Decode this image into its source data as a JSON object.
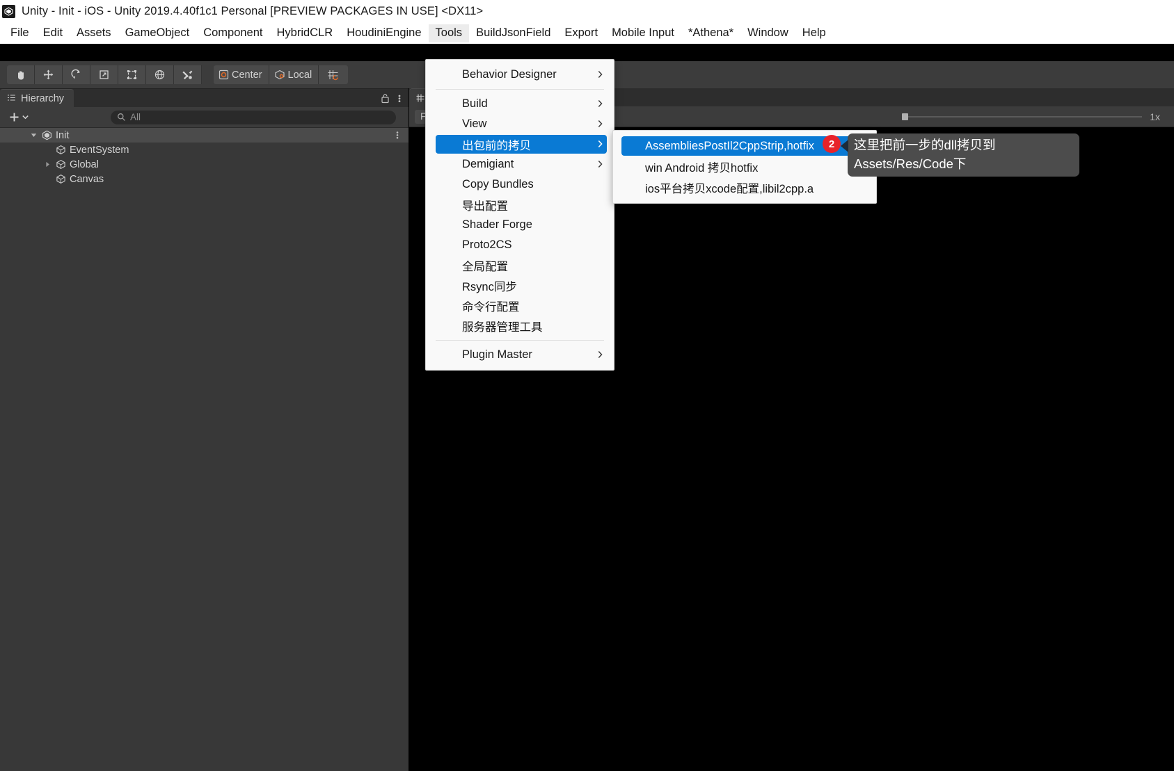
{
  "window": {
    "title": "Unity - Init - iOS - Unity 2019.4.40f1c1 Personal [PREVIEW PACKAGES IN USE] <DX11>",
    "app_icon": "unity-icon"
  },
  "menubar": {
    "items": [
      {
        "label": "File",
        "active": false
      },
      {
        "label": "Edit",
        "active": false
      },
      {
        "label": "Assets",
        "active": false
      },
      {
        "label": "GameObject",
        "active": false
      },
      {
        "label": "Component",
        "active": false
      },
      {
        "label": "HybridCLR",
        "active": false
      },
      {
        "label": "HoudiniEngine",
        "active": false
      },
      {
        "label": "Tools",
        "active": true
      },
      {
        "label": "BuildJsonField",
        "active": false
      },
      {
        "label": "Export",
        "active": false
      },
      {
        "label": "Mobile Input",
        "active": false
      },
      {
        "label": "*Athena*",
        "active": false
      },
      {
        "label": "Window",
        "active": false
      },
      {
        "label": "Help",
        "active": false
      }
    ]
  },
  "toolbar": {
    "tools": [
      {
        "name": "hand-tool"
      },
      {
        "name": "move-tool"
      },
      {
        "name": "rotate-tool"
      },
      {
        "name": "scale-tool"
      },
      {
        "name": "rect-tool"
      },
      {
        "name": "transform-tool"
      },
      {
        "name": "custom-tool"
      }
    ],
    "pivot_mode": "Center",
    "pivot_rotation": "Local",
    "grid_snap": "grid-snap-icon"
  },
  "hierarchy": {
    "tab_label": "Hierarchy",
    "lock_icon": "lock-icon",
    "menu_icon": "kebab-menu-icon",
    "add_label": "+",
    "search": {
      "placeholder": "All",
      "value": "",
      "icon": "search-icon"
    },
    "tree": [
      {
        "label": "Init",
        "depth": 0,
        "icon": "unity-scene-icon",
        "expanded": true,
        "selected": true,
        "has_children": true
      },
      {
        "label": "EventSystem",
        "depth": 1,
        "icon": "gameobject-icon",
        "expanded": false,
        "selected": false,
        "has_children": false
      },
      {
        "label": "Global",
        "depth": 1,
        "icon": "gameobject-icon",
        "expanded": false,
        "selected": false,
        "has_children": true
      },
      {
        "label": "Canvas",
        "depth": 1,
        "icon": "gameobject-icon",
        "expanded": false,
        "selected": false,
        "has_children": false
      }
    ]
  },
  "gameview": {
    "tab_label": "",
    "tab_icon": "game-view-icon",
    "aspect_label": "Fre",
    "zoom_label": "1x"
  },
  "tools_menu": {
    "items": [
      {
        "label": "Behavior Designer",
        "submenu": true,
        "highlight": false,
        "separator_after": true
      },
      {
        "label": "Build",
        "submenu": true,
        "highlight": false,
        "separator_after": false
      },
      {
        "label": "View",
        "submenu": true,
        "highlight": false,
        "separator_after": false
      },
      {
        "label": "出包前的拷贝",
        "submenu": true,
        "highlight": true,
        "separator_after": false
      },
      {
        "label": "Demigiant",
        "submenu": true,
        "highlight": false,
        "separator_after": false
      },
      {
        "label": "Copy Bundles",
        "submenu": false,
        "highlight": false,
        "separator_after": false
      },
      {
        "label": "导出配置",
        "submenu": false,
        "highlight": false,
        "separator_after": false
      },
      {
        "label": "Shader Forge",
        "submenu": false,
        "highlight": false,
        "separator_after": false
      },
      {
        "label": "Proto2CS",
        "submenu": false,
        "highlight": false,
        "separator_after": false
      },
      {
        "label": "全局配置",
        "submenu": false,
        "highlight": false,
        "separator_after": false
      },
      {
        "label": "Rsync同步",
        "submenu": false,
        "highlight": false,
        "separator_after": false
      },
      {
        "label": "命令行配置",
        "submenu": false,
        "highlight": false,
        "separator_after": false
      },
      {
        "label": "服务器管理工具",
        "submenu": false,
        "highlight": false,
        "separator_after": true
      },
      {
        "label": "Plugin Master",
        "submenu": true,
        "highlight": false,
        "separator_after": false
      }
    ]
  },
  "sub_menu": {
    "items": [
      {
        "label": "AssembliesPostIl2CppStrip,hotfix",
        "highlight": true
      },
      {
        "label": "win Android 拷贝hotfix",
        "highlight": false
      },
      {
        "label": "ios平台拷贝xcode配置,libil2cpp.a",
        "highlight": false
      }
    ]
  },
  "annotation": {
    "badge_number": "2",
    "text": "这里把前一步的dll拷贝到Assets/Res/Code下"
  },
  "colors": {
    "highlight_blue": "#0a7ad4",
    "badge_red": "#e8232a",
    "tooltip_bg": "#4c4c4c",
    "editor_bg": "#383838",
    "toolbar_bg": "#3c3c3c"
  }
}
